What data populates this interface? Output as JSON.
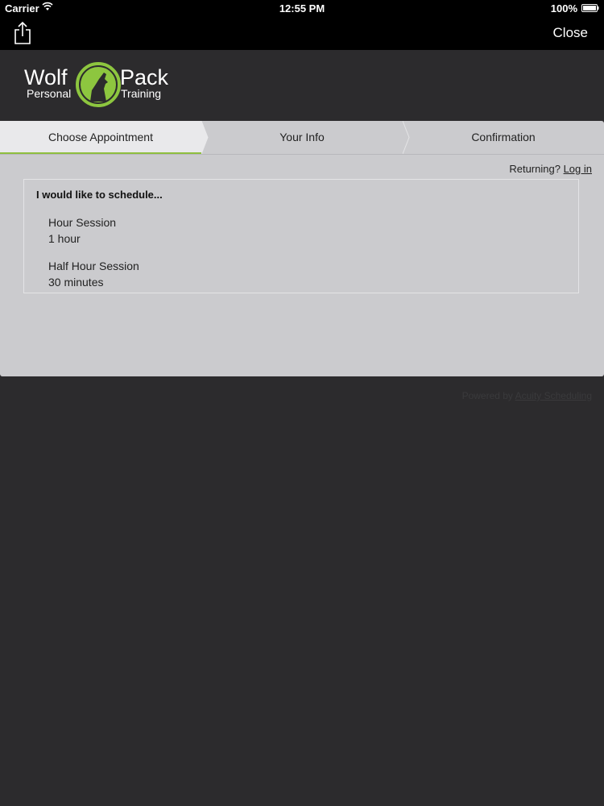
{
  "status_bar": {
    "carrier": "Carrier",
    "time": "12:55 PM",
    "battery": "100%"
  },
  "nav": {
    "close_label": "Close"
  },
  "logo": {
    "word_left": "Wolf",
    "word_right": "Pack",
    "sub_left": "Personal",
    "sub_right": "Training",
    "accent": "#8dc63f"
  },
  "tabs": [
    {
      "label": "Choose Appointment",
      "active": true
    },
    {
      "label": "Your Info",
      "active": false
    },
    {
      "label": "Confirmation",
      "active": false
    }
  ],
  "returning": {
    "prefix": "Returning?",
    "link": "Log in"
  },
  "schedule": {
    "heading": "I would like to schedule...",
    "options": [
      {
        "name": "Hour Session",
        "duration": "1 hour"
      },
      {
        "name": "Half Hour Session",
        "duration": "30 minutes"
      }
    ]
  },
  "footer": {
    "prefix": "Powered by",
    "link": "Acuity Scheduling"
  },
  "colors": {
    "background": "#2c2b2d",
    "panel": "#cbcbce",
    "active_tab_underline": "#8fbf3f"
  }
}
